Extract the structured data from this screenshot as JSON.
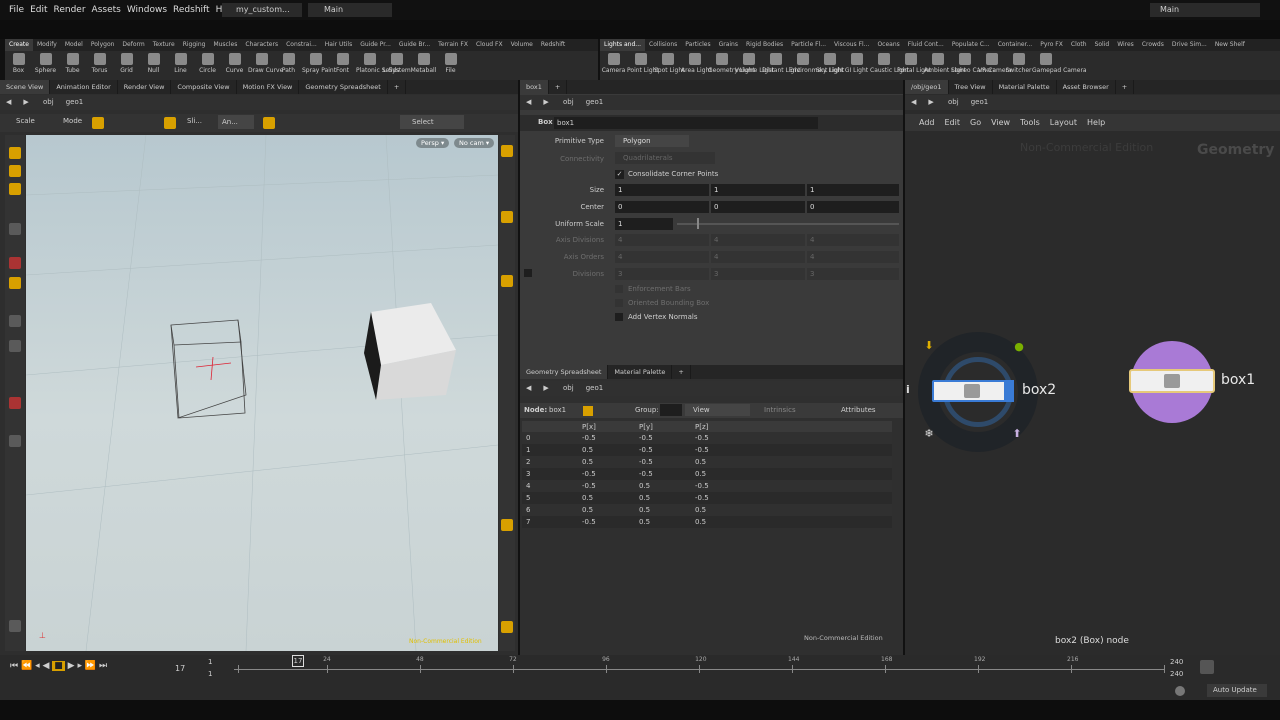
{
  "menu": {
    "items": [
      "File",
      "Edit",
      "Render",
      "Assets",
      "Windows",
      "Redshift",
      "Help"
    ],
    "desktop": "my_custom...",
    "network": "Main",
    "right_desktop": "Main"
  },
  "shelf_left": {
    "tabs": [
      "Create",
      "Modify",
      "Model",
      "Polygon",
      "Deform",
      "Texture",
      "Rigging",
      "Muscles",
      "Characters",
      "Constrai...",
      "Hair Utils",
      "Guide Pr...",
      "Guide Br...",
      "Terrain FX",
      "Cloud FX",
      "Volume",
      "Redshift"
    ],
    "tools": [
      "Box",
      "Sphere",
      "Tube",
      "Torus",
      "Grid",
      "Null",
      "Line",
      "Circle",
      "Curve",
      "Draw Curve",
      "Path",
      "Spray Paint",
      "Font",
      "Platonic Solids",
      "L-System",
      "Metaball",
      "File"
    ]
  },
  "shelf_right": {
    "tabs": [
      "Lights and...",
      "Collisions",
      "Particles",
      "Grains",
      "Rigid Bodies",
      "Particle Fl...",
      "Viscous Fl...",
      "Oceans",
      "Fluid Cont...",
      "Populate C...",
      "Container...",
      "Pyro FX",
      "Cloth",
      "Solid",
      "Wires",
      "Crowds",
      "Drive Sim...",
      "New Shelf"
    ],
    "tools": [
      "Camera",
      "Point Light",
      "Spot Light",
      "Area Light",
      "Geometry Light",
      "Volume Light",
      "Distant Light",
      "Environment Light",
      "Sky Light",
      "GI Light",
      "Caustic Light",
      "Portal Light",
      "Ambient Light",
      "Stereo Camera",
      "VR Camera",
      "Switcher",
      "Gamepad Camera"
    ]
  },
  "scene": {
    "tabs": [
      "Scene View",
      "Animation Editor",
      "Render View",
      "Composite View",
      "Motion FX View",
      "Geometry Spreadsheet"
    ],
    "path_obj": "obj",
    "path_geo": "geo1",
    "toolbar": {
      "scale": "Scale",
      "mode": "Mode",
      "sli": "Sli...",
      "an": "An...",
      "select": "Select"
    },
    "persp": "Persp ▾",
    "cam": "No cam ▾",
    "watermark": "Non-Commercial Edition"
  },
  "params": {
    "tab": "box1",
    "path_obj": "obj",
    "path_geo": "geo1",
    "node_type": "Box",
    "node_name": "box1",
    "primitive_type_label": "Primitive Type",
    "primitive_type": "Polygon",
    "connectivity_label": "Connectivity",
    "connectivity": "Quadrilaterals",
    "consolidate": "Consolidate Corner Points",
    "size_label": "Size",
    "size": [
      "1",
      "1",
      "1"
    ],
    "center_label": "Center",
    "center": [
      "0",
      "0",
      "0"
    ],
    "uniform_scale_label": "Uniform Scale",
    "uniform_scale": "1",
    "axis_divisions_label": "Axis Divisions",
    "axis_divisions": [
      "4",
      "4",
      "4"
    ],
    "axis_orders_label": "Axis Orders",
    "axis_orders": [
      "4",
      "4",
      "4"
    ],
    "divisions_label": "Divisions",
    "divisions": [
      "3",
      "3",
      "3"
    ],
    "enforcement_bars": "Enforcement Bars",
    "oriented_bbox": "Oriented Bounding Box",
    "add_vertex_normals": "Add Vertex Normals"
  },
  "spreadsheet": {
    "tabs": [
      "Geometry Spreadsheet",
      "Material Palette"
    ],
    "path_obj": "obj",
    "path_geo": "geo1",
    "node_label": "Node:",
    "node": "box1",
    "group": "Group:",
    "view": "View",
    "intrinsics": "Intrinsics",
    "attributes": "Attributes",
    "columns": [
      "",
      "P[x]",
      "P[y]",
      "P[z]"
    ],
    "rows": [
      [
        "0",
        "-0.5",
        "-0.5",
        "-0.5"
      ],
      [
        "1",
        "0.5",
        "-0.5",
        "-0.5"
      ],
      [
        "2",
        "0.5",
        "-0.5",
        "0.5"
      ],
      [
        "3",
        "-0.5",
        "-0.5",
        "0.5"
      ],
      [
        "4",
        "-0.5",
        "0.5",
        "-0.5"
      ],
      [
        "5",
        "0.5",
        "0.5",
        "-0.5"
      ],
      [
        "6",
        "0.5",
        "0.5",
        "0.5"
      ],
      [
        "7",
        "-0.5",
        "0.5",
        "0.5"
      ]
    ],
    "watermark": "Non-Commercial Edition"
  },
  "network": {
    "tabs": [
      "/obj/geo1",
      "Tree View",
      "Material Palette",
      "Asset Browser"
    ],
    "path_obj": "obj",
    "path_geo": "geo1",
    "menu": [
      "Add",
      "Edit",
      "Go",
      "View",
      "Tools",
      "Layout",
      "Help"
    ],
    "watermark": "Non-Commercial Edition",
    "context": "Geometry",
    "node_a": "box2",
    "node_b": "box1",
    "status": "box2 (Box) node",
    "info": "i"
  },
  "timeline": {
    "frame": "17",
    "start": "1",
    "start2": "1",
    "ticks": [
      "1",
      "24",
      "48",
      "72",
      "96",
      "120",
      "144",
      "168",
      "192",
      "216",
      "240"
    ],
    "current_tick": "17",
    "end": "240",
    "end2": "240",
    "auto_update": "Auto Update"
  }
}
